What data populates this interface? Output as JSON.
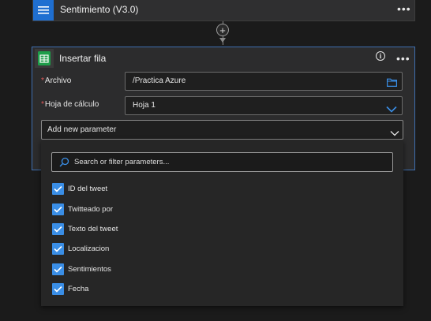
{
  "top_card": {
    "title": "Sentimiento (V3.0)"
  },
  "main_card": {
    "title": "Insertar fila",
    "fields": [
      {
        "required_mark": "*",
        "label": "Archivo",
        "value": "/Practica Azure"
      },
      {
        "required_mark": "*",
        "label": "Hoja de cálculo",
        "value": "Hoja 1"
      }
    ],
    "add_parameter": "Add new parameter"
  },
  "parameters_dropdown": {
    "search_placeholder": "Search or filter parameters...",
    "options": [
      {
        "label": "ID del tweet",
        "checked": true
      },
      {
        "label": "Twitteado por",
        "checked": true
      },
      {
        "label": "Texto del tweet",
        "checked": true
      },
      {
        "label": "Localizacion",
        "checked": true
      },
      {
        "label": "Sentimientos",
        "checked": true
      },
      {
        "label": "Fecha",
        "checked": true
      }
    ]
  },
  "colors": {
    "accent": "#1f6fd1",
    "checkbox": "#3a8ee6",
    "required": "#e05a5a",
    "card_border_active": "#3f6fb0"
  }
}
